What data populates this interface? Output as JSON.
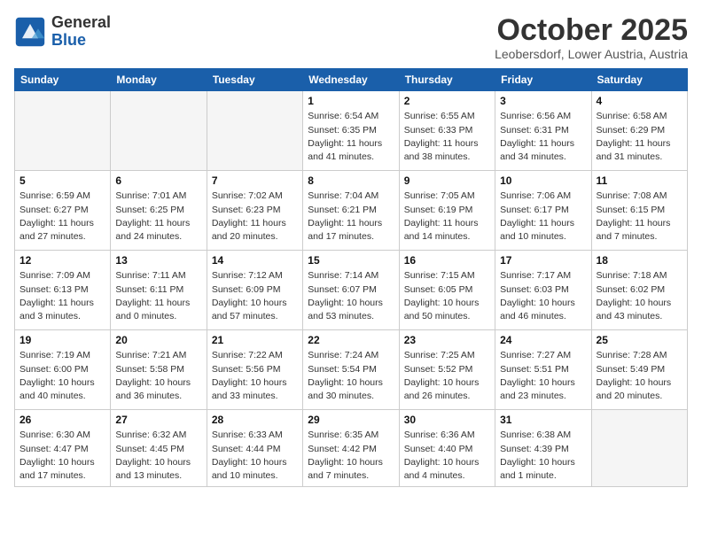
{
  "header": {
    "logo_general": "General",
    "logo_blue": "Blue",
    "month": "October 2025",
    "location": "Leobersdorf, Lower Austria, Austria"
  },
  "weekdays": [
    "Sunday",
    "Monday",
    "Tuesday",
    "Wednesday",
    "Thursday",
    "Friday",
    "Saturday"
  ],
  "weeks": [
    [
      {
        "day": "",
        "detail": ""
      },
      {
        "day": "",
        "detail": ""
      },
      {
        "day": "",
        "detail": ""
      },
      {
        "day": "1",
        "detail": "Sunrise: 6:54 AM\nSunset: 6:35 PM\nDaylight: 11 hours\nand 41 minutes."
      },
      {
        "day": "2",
        "detail": "Sunrise: 6:55 AM\nSunset: 6:33 PM\nDaylight: 11 hours\nand 38 minutes."
      },
      {
        "day": "3",
        "detail": "Sunrise: 6:56 AM\nSunset: 6:31 PM\nDaylight: 11 hours\nand 34 minutes."
      },
      {
        "day": "4",
        "detail": "Sunrise: 6:58 AM\nSunset: 6:29 PM\nDaylight: 11 hours\nand 31 minutes."
      }
    ],
    [
      {
        "day": "5",
        "detail": "Sunrise: 6:59 AM\nSunset: 6:27 PM\nDaylight: 11 hours\nand 27 minutes."
      },
      {
        "day": "6",
        "detail": "Sunrise: 7:01 AM\nSunset: 6:25 PM\nDaylight: 11 hours\nand 24 minutes."
      },
      {
        "day": "7",
        "detail": "Sunrise: 7:02 AM\nSunset: 6:23 PM\nDaylight: 11 hours\nand 20 minutes."
      },
      {
        "day": "8",
        "detail": "Sunrise: 7:04 AM\nSunset: 6:21 PM\nDaylight: 11 hours\nand 17 minutes."
      },
      {
        "day": "9",
        "detail": "Sunrise: 7:05 AM\nSunset: 6:19 PM\nDaylight: 11 hours\nand 14 minutes."
      },
      {
        "day": "10",
        "detail": "Sunrise: 7:06 AM\nSunset: 6:17 PM\nDaylight: 11 hours\nand 10 minutes."
      },
      {
        "day": "11",
        "detail": "Sunrise: 7:08 AM\nSunset: 6:15 PM\nDaylight: 11 hours\nand 7 minutes."
      }
    ],
    [
      {
        "day": "12",
        "detail": "Sunrise: 7:09 AM\nSunset: 6:13 PM\nDaylight: 11 hours\nand 3 minutes."
      },
      {
        "day": "13",
        "detail": "Sunrise: 7:11 AM\nSunset: 6:11 PM\nDaylight: 11 hours\nand 0 minutes."
      },
      {
        "day": "14",
        "detail": "Sunrise: 7:12 AM\nSunset: 6:09 PM\nDaylight: 10 hours\nand 57 minutes."
      },
      {
        "day": "15",
        "detail": "Sunrise: 7:14 AM\nSunset: 6:07 PM\nDaylight: 10 hours\nand 53 minutes."
      },
      {
        "day": "16",
        "detail": "Sunrise: 7:15 AM\nSunset: 6:05 PM\nDaylight: 10 hours\nand 50 minutes."
      },
      {
        "day": "17",
        "detail": "Sunrise: 7:17 AM\nSunset: 6:03 PM\nDaylight: 10 hours\nand 46 minutes."
      },
      {
        "day": "18",
        "detail": "Sunrise: 7:18 AM\nSunset: 6:02 PM\nDaylight: 10 hours\nand 43 minutes."
      }
    ],
    [
      {
        "day": "19",
        "detail": "Sunrise: 7:19 AM\nSunset: 6:00 PM\nDaylight: 10 hours\nand 40 minutes."
      },
      {
        "day": "20",
        "detail": "Sunrise: 7:21 AM\nSunset: 5:58 PM\nDaylight: 10 hours\nand 36 minutes."
      },
      {
        "day": "21",
        "detail": "Sunrise: 7:22 AM\nSunset: 5:56 PM\nDaylight: 10 hours\nand 33 minutes."
      },
      {
        "day": "22",
        "detail": "Sunrise: 7:24 AM\nSunset: 5:54 PM\nDaylight: 10 hours\nand 30 minutes."
      },
      {
        "day": "23",
        "detail": "Sunrise: 7:25 AM\nSunset: 5:52 PM\nDaylight: 10 hours\nand 26 minutes."
      },
      {
        "day": "24",
        "detail": "Sunrise: 7:27 AM\nSunset: 5:51 PM\nDaylight: 10 hours\nand 23 minutes."
      },
      {
        "day": "25",
        "detail": "Sunrise: 7:28 AM\nSunset: 5:49 PM\nDaylight: 10 hours\nand 20 minutes."
      }
    ],
    [
      {
        "day": "26",
        "detail": "Sunrise: 6:30 AM\nSunset: 4:47 PM\nDaylight: 10 hours\nand 17 minutes."
      },
      {
        "day": "27",
        "detail": "Sunrise: 6:32 AM\nSunset: 4:45 PM\nDaylight: 10 hours\nand 13 minutes."
      },
      {
        "day": "28",
        "detail": "Sunrise: 6:33 AM\nSunset: 4:44 PM\nDaylight: 10 hours\nand 10 minutes."
      },
      {
        "day": "29",
        "detail": "Sunrise: 6:35 AM\nSunset: 4:42 PM\nDaylight: 10 hours\nand 7 minutes."
      },
      {
        "day": "30",
        "detail": "Sunrise: 6:36 AM\nSunset: 4:40 PM\nDaylight: 10 hours\nand 4 minutes."
      },
      {
        "day": "31",
        "detail": "Sunrise: 6:38 AM\nSunset: 4:39 PM\nDaylight: 10 hours\nand 1 minute."
      },
      {
        "day": "",
        "detail": ""
      }
    ]
  ]
}
